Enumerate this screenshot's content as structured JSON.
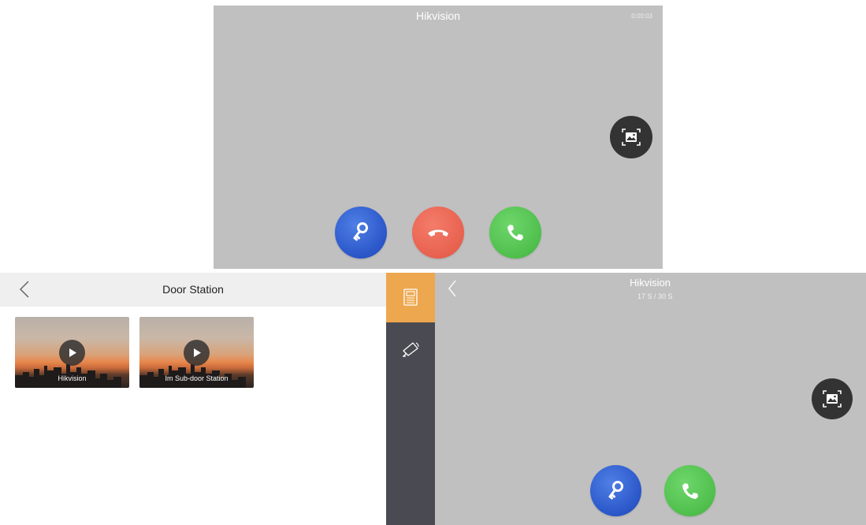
{
  "top_call": {
    "caller_name": "Hikvision",
    "timer": "0:00:03",
    "buttons": {
      "snapshot_icon": "capture-image-icon",
      "unlock_icon": "key-icon",
      "hangup_icon": "hangup-phone-icon",
      "answer_icon": "phone-icon"
    }
  },
  "door_station": {
    "title": "Door Station",
    "back_icon": "chevron-left-icon",
    "tiles": [
      {
        "label": "Hikvision"
      },
      {
        "label": "Im Sub-door Station"
      }
    ]
  },
  "side_rail": {
    "items": [
      {
        "icon": "door-station-icon",
        "active": true
      },
      {
        "icon": "camera-icon",
        "active": false
      }
    ]
  },
  "bottom_call": {
    "caller_name": "Hikvision",
    "countdown": "17 S / 30 S",
    "back_icon": "chevron-left-icon"
  },
  "colors": {
    "call_background": "#c0c0c0",
    "unlock_blue": "#2a56c8",
    "hangup_red": "#e8614f",
    "answer_green": "#4fbf4c",
    "rail_active": "#eda74e",
    "rail_background": "#4a4a52"
  }
}
